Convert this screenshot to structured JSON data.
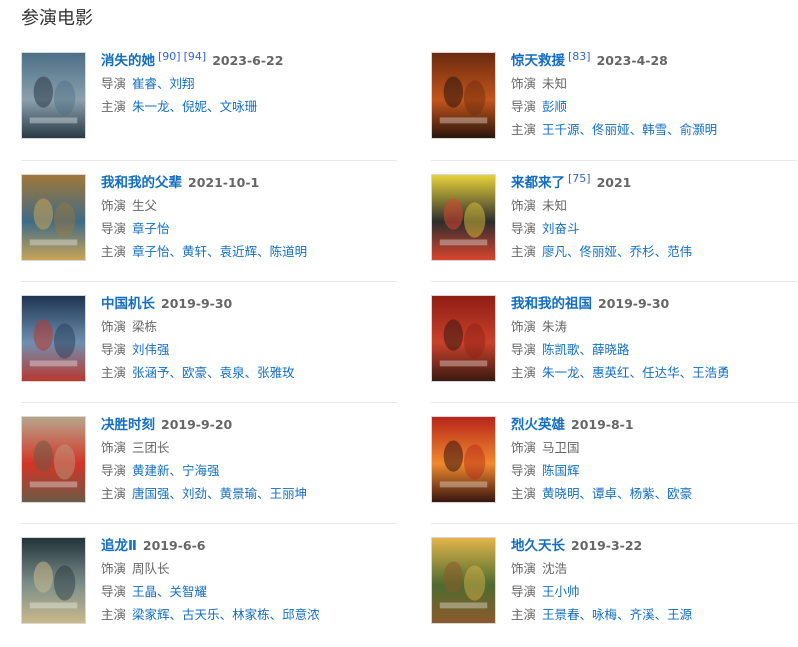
{
  "section_title": "参演电影",
  "labels": {
    "role": "饰演",
    "director": "导演",
    "starring": "主演"
  },
  "delimiter": "、",
  "movies": [
    {
      "title": "消失的她",
      "refs": [
        "[90]",
        "[94]"
      ],
      "date": "2023-6-22",
      "role": "",
      "directors": [
        "崔睿",
        "刘翔"
      ],
      "stars": [
        "朱一龙",
        "倪妮",
        "文咏珊"
      ],
      "poster_colors": [
        "#4d6f86",
        "#8aa0ad",
        "#2a3b47"
      ]
    },
    {
      "title": "惊天救援",
      "refs": [
        "[83]"
      ],
      "date": "2023-4-28",
      "role": "未知",
      "directors": [
        "彭顺"
      ],
      "stars": [
        "王千源",
        "佟丽娅",
        "韩雪",
        "俞灏明"
      ],
      "poster_colors": [
        "#6b2a10",
        "#c4551b",
        "#2a160c"
      ]
    },
    {
      "title": "我和我的父辈",
      "refs": [],
      "date": "2021-10-1",
      "role": "生父",
      "directors": [
        "章子怡"
      ],
      "stars": [
        "章子怡",
        "黄轩",
        "袁近辉",
        "陈道明"
      ],
      "poster_colors": [
        "#a0773a",
        "#3f6b86",
        "#c9a457"
      ]
    },
    {
      "title": "来都来了",
      "refs": [
        "[75]"
      ],
      "date": "2021",
      "role": "未知",
      "directors": [
        "刘奋斗"
      ],
      "stars": [
        "廖凡",
        "佟丽娅",
        "乔杉",
        "范伟"
      ],
      "poster_colors": [
        "#e8d13a",
        "#2d2d2d",
        "#d9452f"
      ]
    },
    {
      "title": "中国机长",
      "refs": [],
      "date": "2019-9-30",
      "role": "梁栋",
      "directors": [
        "刘伟强"
      ],
      "stars": [
        "张涵予",
        "欧豪",
        "袁泉",
        "张雅玫"
      ],
      "poster_colors": [
        "#1e3552",
        "#6f8fb0",
        "#b9382f"
      ]
    },
    {
      "title": "我和我的祖国",
      "refs": [],
      "date": "2019-9-30",
      "role": "朱涛",
      "directors": [
        "陈凯歌",
        "薛晓路"
      ],
      "stars": [
        "朱一龙",
        "惠英红",
        "任达华",
        "王浩勇"
      ],
      "poster_colors": [
        "#8f1e14",
        "#c9412b",
        "#3a1a10"
      ]
    },
    {
      "title": "决胜时刻",
      "refs": [],
      "date": "2019-9-20",
      "role": "三团长",
      "directors": [
        "黄建新",
        "宁海强"
      ],
      "stars": [
        "唐国强",
        "刘劲",
        "黄景瑜",
        "王丽坤"
      ],
      "poster_colors": [
        "#b7a58a",
        "#d43426",
        "#6b5a46"
      ]
    },
    {
      "title": "烈火英雄",
      "refs": [],
      "date": "2019-8-1",
      "role": "马卫国",
      "directors": [
        "陈国辉"
      ],
      "stars": [
        "黄晓明",
        "谭卓",
        "杨紫",
        "欧豪"
      ],
      "poster_colors": [
        "#b8261b",
        "#f08a2c",
        "#3a1410"
      ]
    },
    {
      "title": "追龙Ⅱ",
      "refs": [],
      "date": "2019-6-6",
      "role": "周队长",
      "directors": [
        "王晶",
        "关智耀"
      ],
      "stars": [
        "梁家辉",
        "古天乐",
        "林家栋",
        "邱意浓"
      ],
      "poster_colors": [
        "#23343b",
        "#7d8f8a",
        "#c9b98a"
      ]
    },
    {
      "title": "地久天长",
      "refs": [],
      "date": "2019-3-22",
      "role": "沈浩",
      "directors": [
        "王小帅"
      ],
      "stars": [
        "王景春",
        "咏梅",
        "齐溪",
        "王源"
      ],
      "poster_colors": [
        "#e1b54a",
        "#4e6b2f",
        "#8b5a2b"
      ]
    }
  ]
}
